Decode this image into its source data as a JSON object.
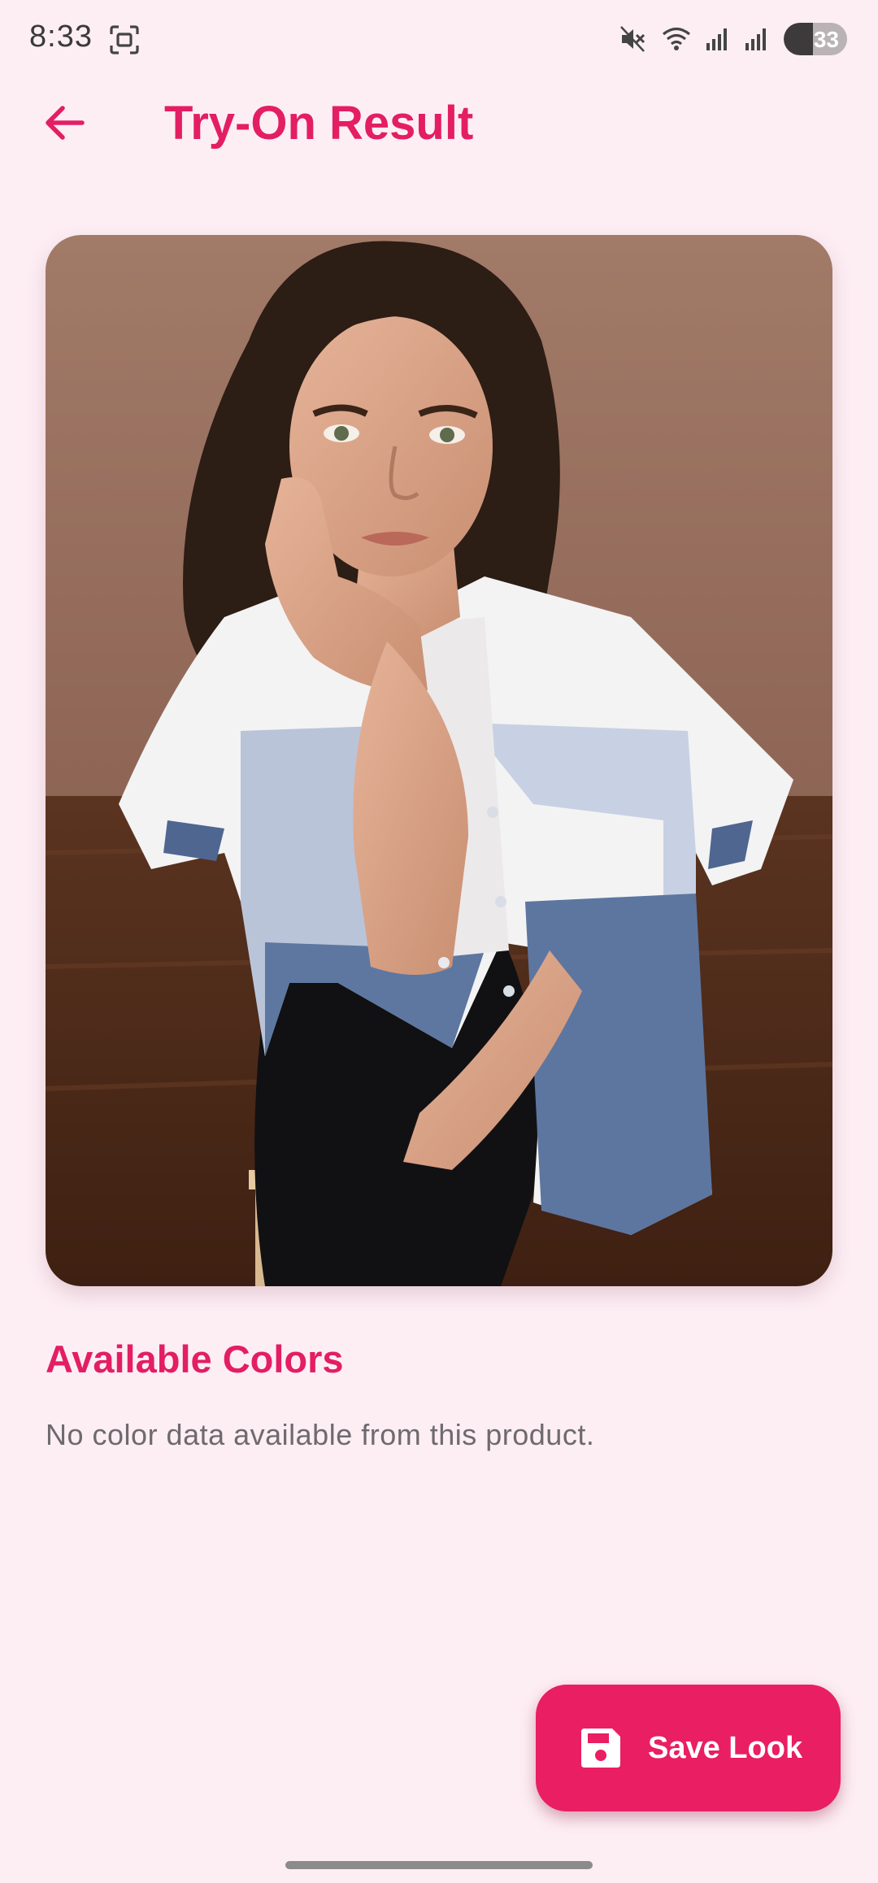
{
  "status_bar": {
    "time": "8:33",
    "battery_level": "33",
    "icons": [
      "screenshot-icon",
      "mute-icon",
      "wifi-icon",
      "signal-icon",
      "signal-icon",
      "battery-icon"
    ]
  },
  "app_bar": {
    "back_icon": "arrow-back-icon",
    "title": "Try-On Result"
  },
  "result_image": {
    "description_icon": "photo"
  },
  "colors_section": {
    "title": "Available Colors",
    "empty_message": "No color data available from this product."
  },
  "save_button": {
    "label": "Save Look",
    "icon": "save-icon"
  },
  "theme": {
    "accent": "#e91e63",
    "title_color": "#e31e63",
    "background": "#fdeef4"
  }
}
